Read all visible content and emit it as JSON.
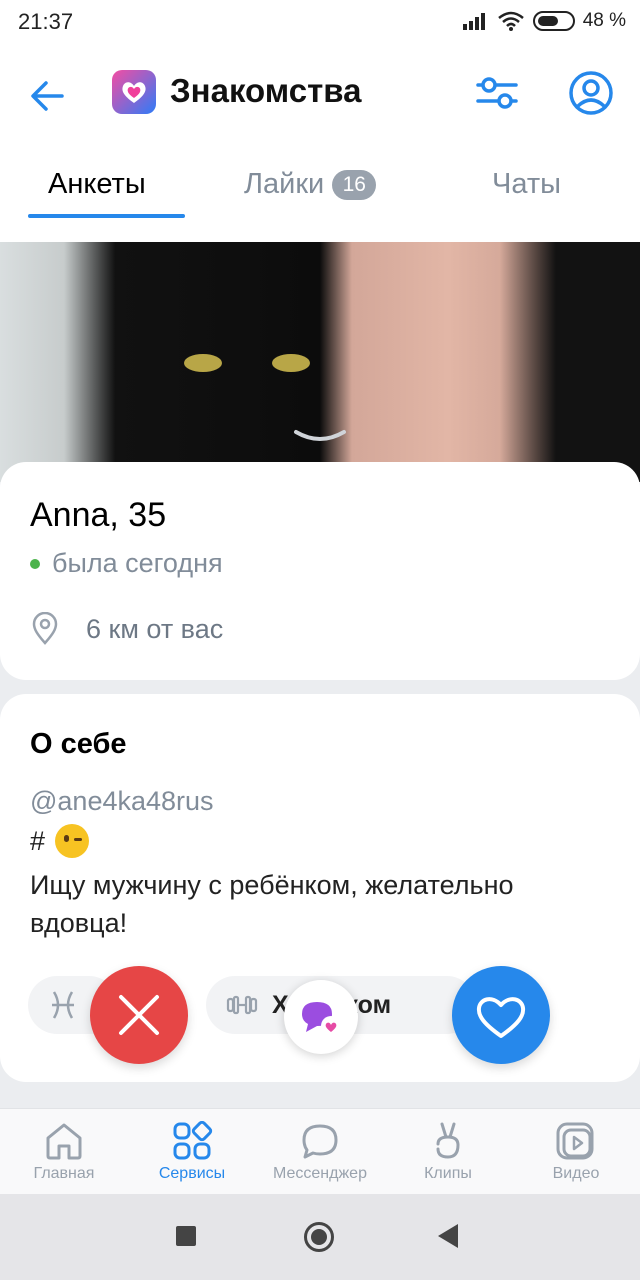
{
  "status_bar": {
    "time": "21:37",
    "battery": "48 %"
  },
  "header": {
    "title": "Знакомства"
  },
  "tabs": [
    {
      "label": "Анкеты",
      "active": true
    },
    {
      "label": "Лайки",
      "badge": "16"
    },
    {
      "label": "Чаты"
    }
  ],
  "profile": {
    "name_age": "Anna, 35",
    "status": "была сегодня",
    "distance": "6 км от вас"
  },
  "about": {
    "title": "О себе",
    "handle": "@ane4ka48rus",
    "hash": "#",
    "text": "Ищу мужчину с ребёнком, желательно вдовца!",
    "chips": [
      {
        "icon": "pisces-icon",
        "label": ""
      },
      {
        "icon": "dumbbell-icon",
        "label": "Х   пешком"
      }
    ]
  },
  "bottom_nav": [
    {
      "label": "Главная",
      "icon": "home-icon"
    },
    {
      "label": "Сервисы",
      "icon": "services-icon",
      "active": true
    },
    {
      "label": "Мессенджер",
      "icon": "message-icon"
    },
    {
      "label": "Клипы",
      "icon": "clips-icon"
    },
    {
      "label": "Видео",
      "icon": "video-icon"
    }
  ],
  "colors": {
    "accent": "#2688eb",
    "dislike": "#e64646",
    "online": "#4bb34b"
  }
}
